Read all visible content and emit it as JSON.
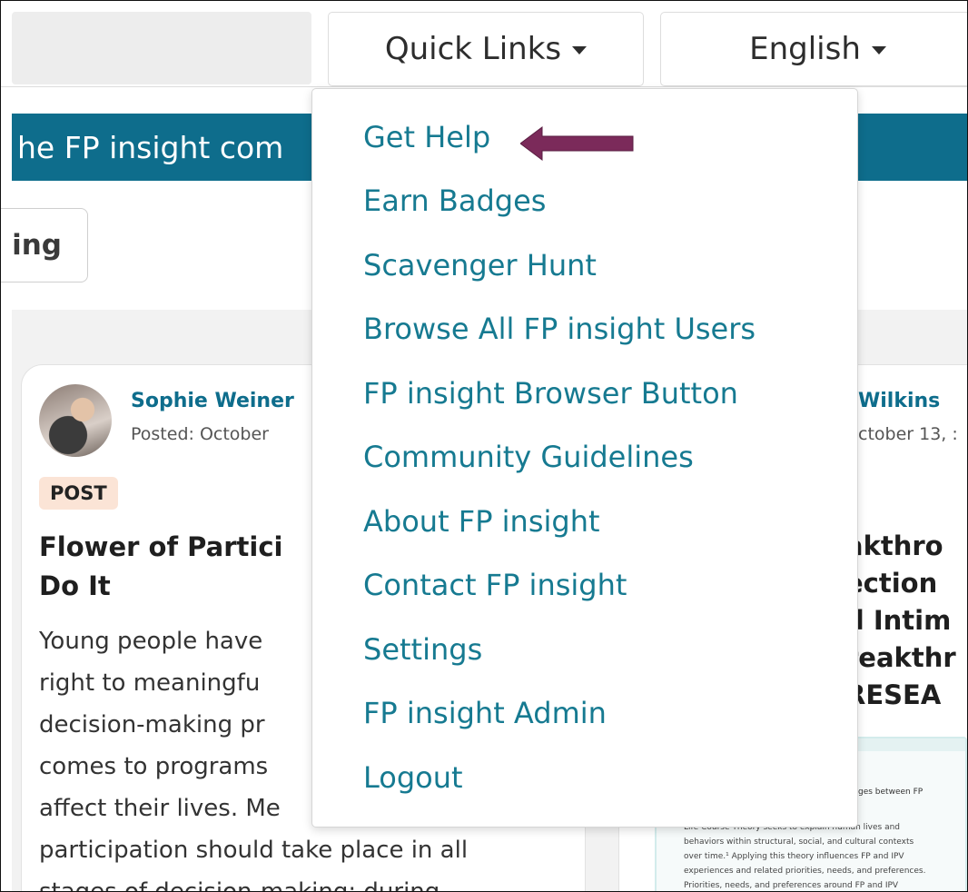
{
  "topbar": {
    "quick_links_label": "Quick Links",
    "language_label": "English"
  },
  "banner": {
    "text": "he FP insight com"
  },
  "partial_button": {
    "label": "ing"
  },
  "quick_links_menu": {
    "items": [
      "Get Help",
      "Earn Badges",
      "Scavenger Hunt",
      "Browse All FP insight Users",
      "FP insight Browser Button",
      "Community Guidelines",
      "About FP insight",
      "Contact FP insight",
      "Settings",
      "FP insight Admin",
      "Logout"
    ],
    "highlight_arrow_color": "#7b2a5a"
  },
  "post_left": {
    "author": "Sophie Weiner",
    "posted": "Posted: October",
    "badge": "POST",
    "title_lines": [
      "Flower of Partici",
      "Do It"
    ],
    "body_lines": [
      "Young people have",
      "right to meaningfu",
      "decision-making pr",
      "comes to programs",
      "affect their lives. Me",
      "participation should take place in all",
      "stages of decision-making: during"
    ]
  },
  "post_right": {
    "author": "Wilkins",
    "posted": "ctober 13, :",
    "title_lines": [
      "akthro",
      "ection",
      "d Intim",
      "reakthr",
      "RESEA"
    ],
    "thumbnail": {
      "heading": "ges between FP",
      "text_lines": [
        "Life Course Theory seeks to explain human lives and",
        "behaviors within structural, social, and cultural contexts",
        "over time.¹ Applying this theory influences FP and IPV",
        "experiences and related priorities, needs, and preferences.",
        "Priorities, needs, and preferences around FP and IPV"
      ]
    }
  },
  "colors": {
    "brand_teal": "#0e6d8c",
    "link_teal": "#167a91",
    "badge_bg": "#fbe4d6"
  }
}
